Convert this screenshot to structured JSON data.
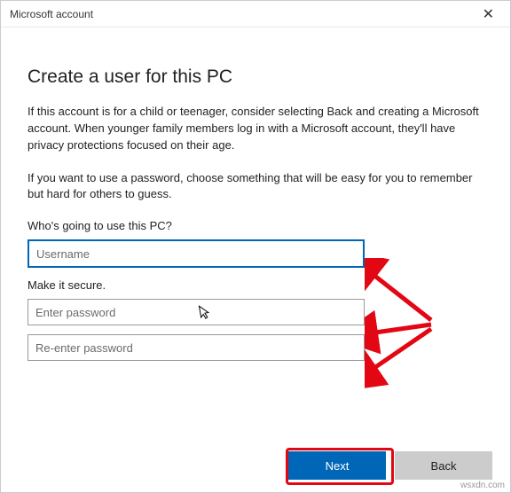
{
  "window": {
    "title": "Microsoft account",
    "close_label": "✕"
  },
  "content": {
    "heading": "Create a user for this PC",
    "paragraph1": "If this account is for a child or teenager, consider selecting Back and creating a Microsoft account. When younger family members log in with a Microsoft account, they'll have privacy protections focused on their age.",
    "paragraph2": "If you want to use a password, choose something that will be easy for you to remember but hard for others to guess.",
    "username_label": "Who's going to use this PC?",
    "username_placeholder": "Username",
    "secure_label": "Make it secure.",
    "password_placeholder": "Enter password",
    "repassword_placeholder": "Re-enter password"
  },
  "buttons": {
    "next_label": "Next",
    "back_label": "Back"
  },
  "watermark": "wsxdn.com",
  "colors": {
    "accent": "#0067B8",
    "arrow": "#e30613"
  }
}
